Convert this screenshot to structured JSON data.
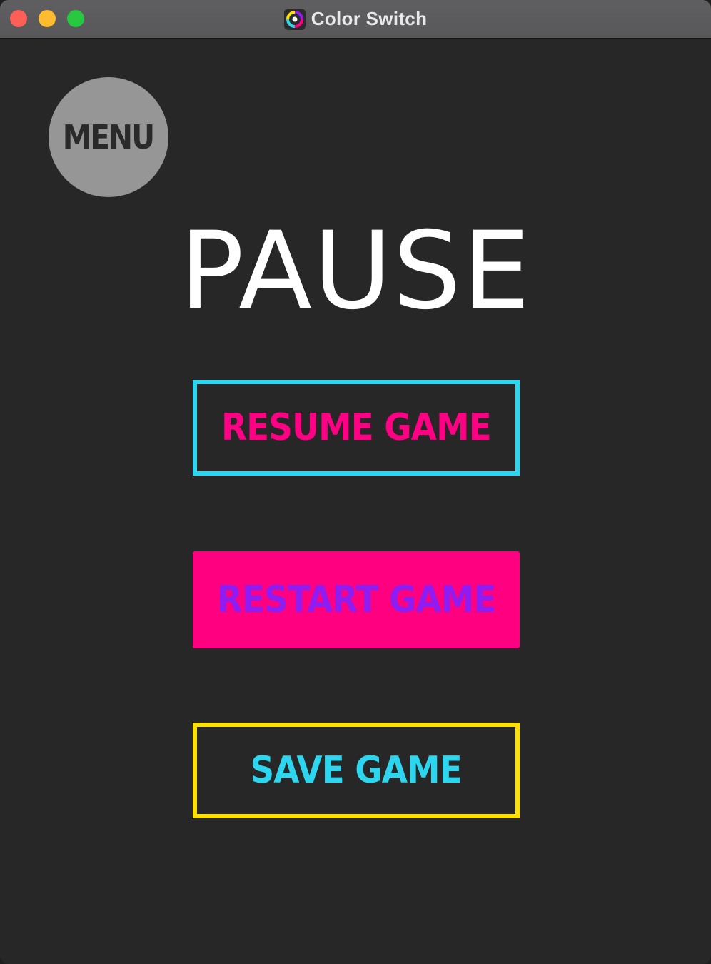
{
  "window": {
    "title": "Color Switch",
    "app_icon": "color-switch-icon"
  },
  "menu_button": {
    "label": "MENU"
  },
  "pause_title": "PAUSE",
  "buttons": {
    "resume": {
      "label": "RESUME GAME",
      "border_color": "#2dd5ee",
      "text_color": "#ff0085"
    },
    "restart": {
      "label": "RESTART GAME",
      "fill_color": "#ff0081",
      "text_color": "#8f1cf0"
    },
    "save": {
      "label": "SAVE GAME",
      "border_color": "#fce003",
      "text_color": "#2dd5ee"
    }
  },
  "colors": {
    "background": "#272727",
    "menu_circle": "#969696",
    "title_text": "#ffffff"
  }
}
